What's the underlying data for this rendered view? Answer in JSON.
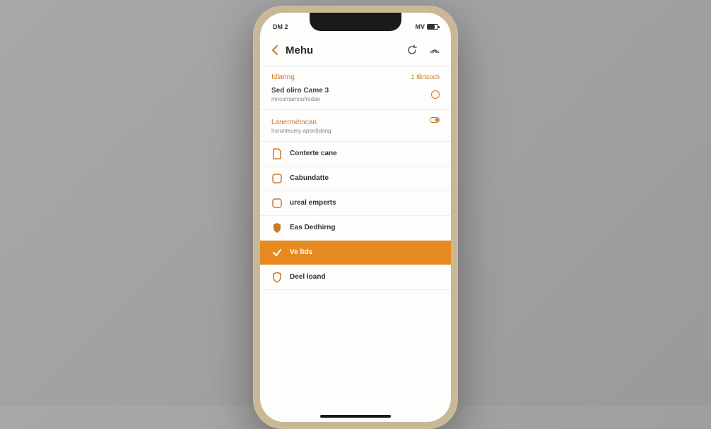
{
  "status": {
    "left": "DM 2",
    "right": "MV"
  },
  "nav": {
    "title": "Mehu"
  },
  "section1": {
    "title": "Idlaring",
    "badge": "1 IBrtcoch",
    "sub": "Sed oliro Came 3",
    "sub2": "mncomamoufredae"
  },
  "section2": {
    "title": "Lanermétncan",
    "sub": "horunteumy apordidang"
  },
  "menu": {
    "items": [
      {
        "icon": "document",
        "label": "Conterte cane"
      },
      {
        "icon": "square",
        "label": "Cabundatte"
      },
      {
        "icon": "square",
        "label": "ureal emperts"
      },
      {
        "icon": "shield",
        "label": "Eas Dedhirng"
      },
      {
        "icon": "check",
        "label": "Ve ltds",
        "selected": true
      },
      {
        "icon": "shield-outline",
        "label": "Deel loand"
      }
    ]
  }
}
